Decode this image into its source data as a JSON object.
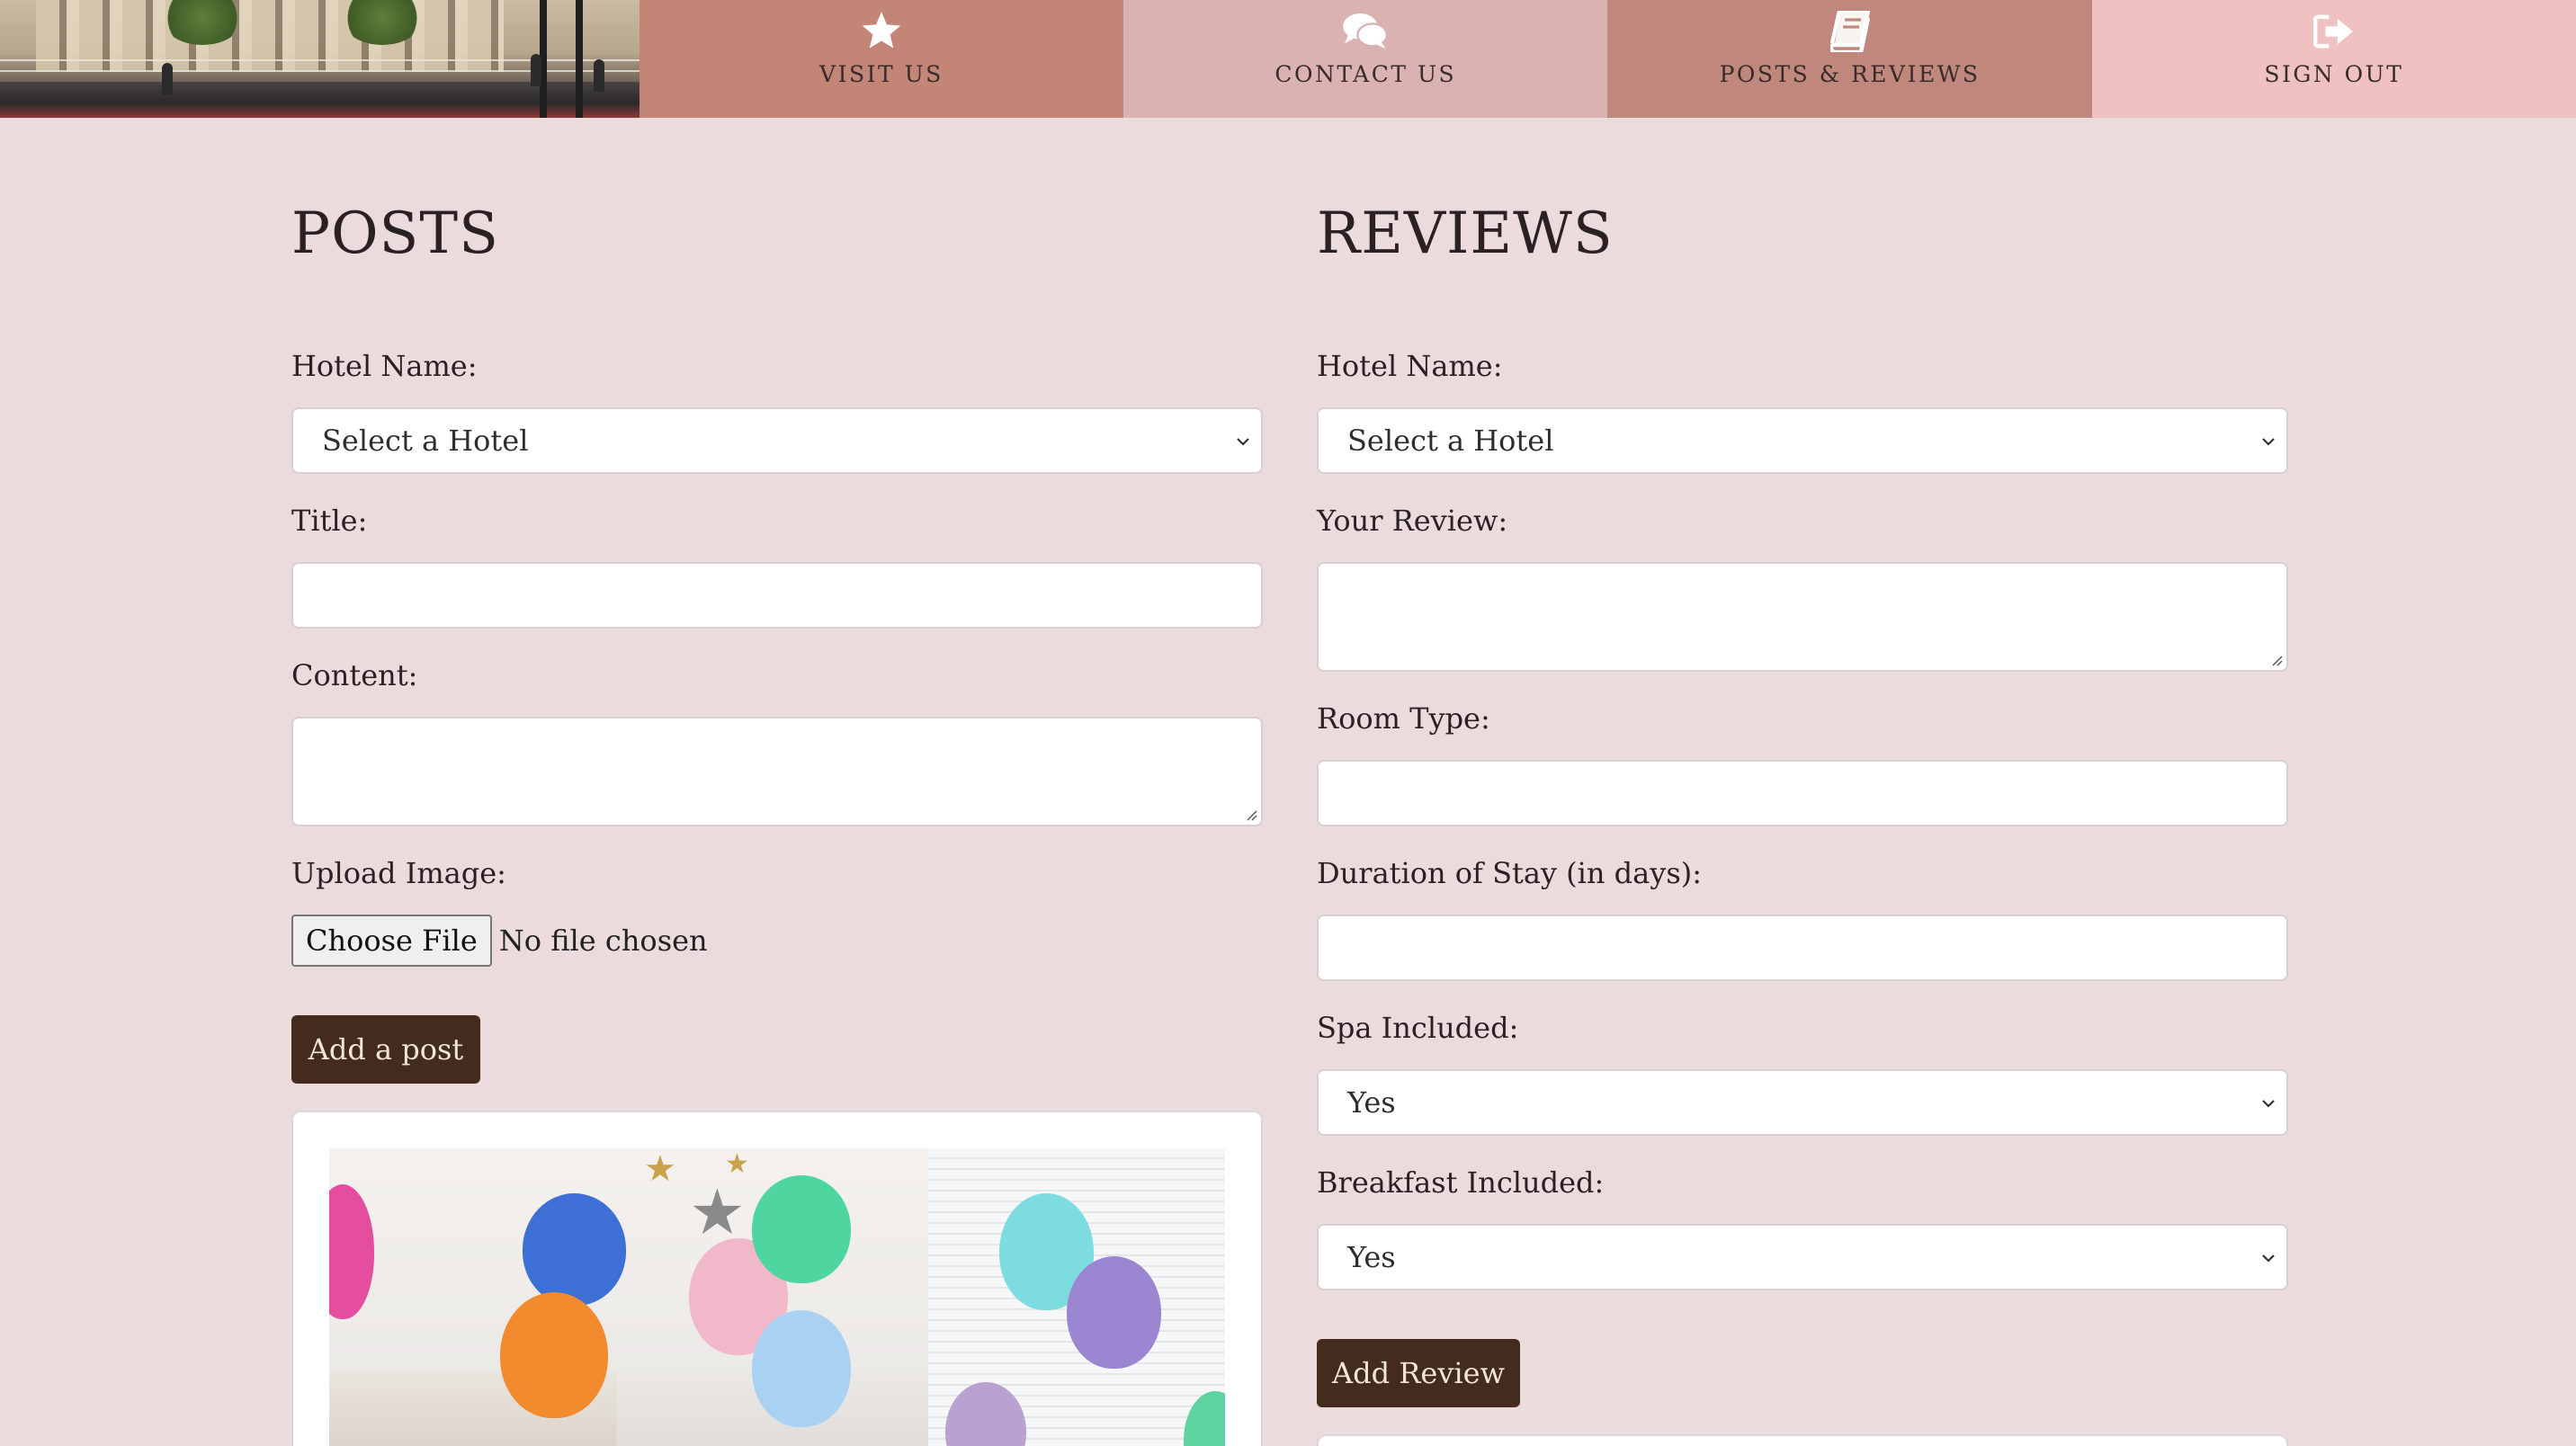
{
  "nav": {
    "items": [
      {
        "label": "VISIT US",
        "icon": "star-icon"
      },
      {
        "label": "CONTACT US",
        "icon": "chat-bubbles-icon"
      },
      {
        "label": "POSTS & REVIEWS",
        "icon": "book-icon"
      },
      {
        "label": "SIGN OUT",
        "icon": "sign-out-icon"
      }
    ]
  },
  "posts": {
    "title": "POSTS",
    "hotel_label": "Hotel Name:",
    "hotel_value": "Select a Hotel",
    "title_label": "Title:",
    "title_value": "",
    "content_label": "Content:",
    "content_value": "",
    "upload_label": "Upload Image:",
    "file_button": "Choose File",
    "file_status": "No file chosen",
    "submit": "Add a post"
  },
  "reviews": {
    "title": "REVIEWS",
    "hotel_label": "Hotel Name:",
    "hotel_value": "Select a Hotel",
    "review_label": "Your Review:",
    "review_value": "",
    "room_label": "Room Type:",
    "room_value": "",
    "duration_label": "Duration of Stay (in days):",
    "duration_value": "",
    "spa_label": "Spa Included:",
    "spa_value": "Yes",
    "breakfast_label": "Breakfast Included:",
    "breakfast_value": "Yes",
    "submit": "Add Review"
  },
  "colors": {
    "page_bg": "#ecdbdc",
    "nav_visit": "#c38575",
    "nav_contact": "#dbb2b2",
    "nav_posts": "#c0877d",
    "nav_signout": "#efc1c1",
    "button_bg": "#432b1e"
  }
}
